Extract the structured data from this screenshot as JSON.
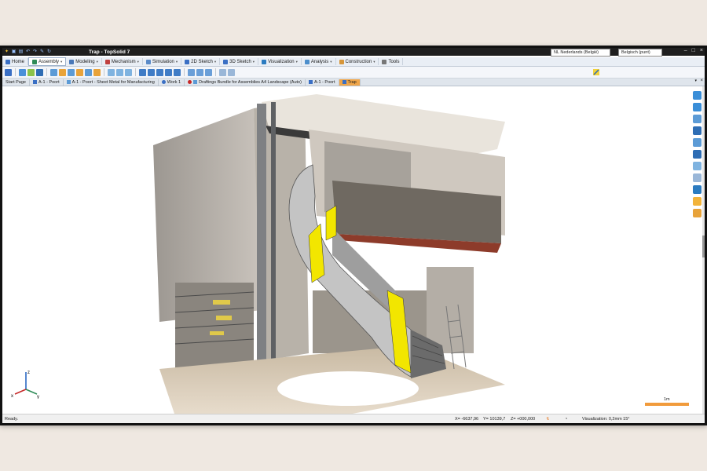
{
  "window": {
    "title": "Trap - TopSolid 7",
    "locale_language": "NL Nederlands (België)",
    "locale_keyboard": "Belgisch (punt)"
  },
  "ribbon_tabs": [
    {
      "label": "Home",
      "color": "#3a6fc4"
    },
    {
      "label": "Assembly",
      "color": "#2e8b57",
      "active": true
    },
    {
      "label": "Modeling",
      "color": "#4a78b8"
    },
    {
      "label": "Mechanism",
      "color": "#c04040"
    },
    {
      "label": "Simulation",
      "color": "#5a8ac8"
    },
    {
      "label": "2D Sketch",
      "color": "#3a6fc4"
    },
    {
      "label": "3D Sketch",
      "color": "#3a6fc4"
    },
    {
      "label": "Visualization",
      "color": "#2b7bc0"
    },
    {
      "label": "Analysis",
      "color": "#4d8fcc"
    },
    {
      "label": "Construction",
      "color": "#d6963a"
    },
    {
      "label": "Tools",
      "color": "#777777"
    }
  ],
  "doc_tabs": [
    {
      "label": "Start Page"
    },
    {
      "label": "A-1 - Poort"
    },
    {
      "label": "A-1 - Poort - Sheet Metal for Manufacturing"
    },
    {
      "label": "Work 1"
    },
    {
      "label": "Draftings Bundle for Assemblies A4 Landscape (Auto)"
    },
    {
      "label": "A-1 - Poort"
    },
    {
      "label": "Trap",
      "active": true
    }
  ],
  "viewport": {
    "scale_label": "1m",
    "axis_labels": {
      "x": "x",
      "y": "y",
      "z": "z"
    }
  },
  "status": {
    "text": "Ready.",
    "x_coord": "X= -6637,96",
    "y_coord": "Y= 10139,7",
    "z_coord": "Z= +000,000",
    "visualization": "Visualization: 0,2mm 15°"
  },
  "colors": {
    "accent": "#f0a64a",
    "stair_yellow": "#f2e600",
    "titlebar": "#1f1f1f"
  }
}
